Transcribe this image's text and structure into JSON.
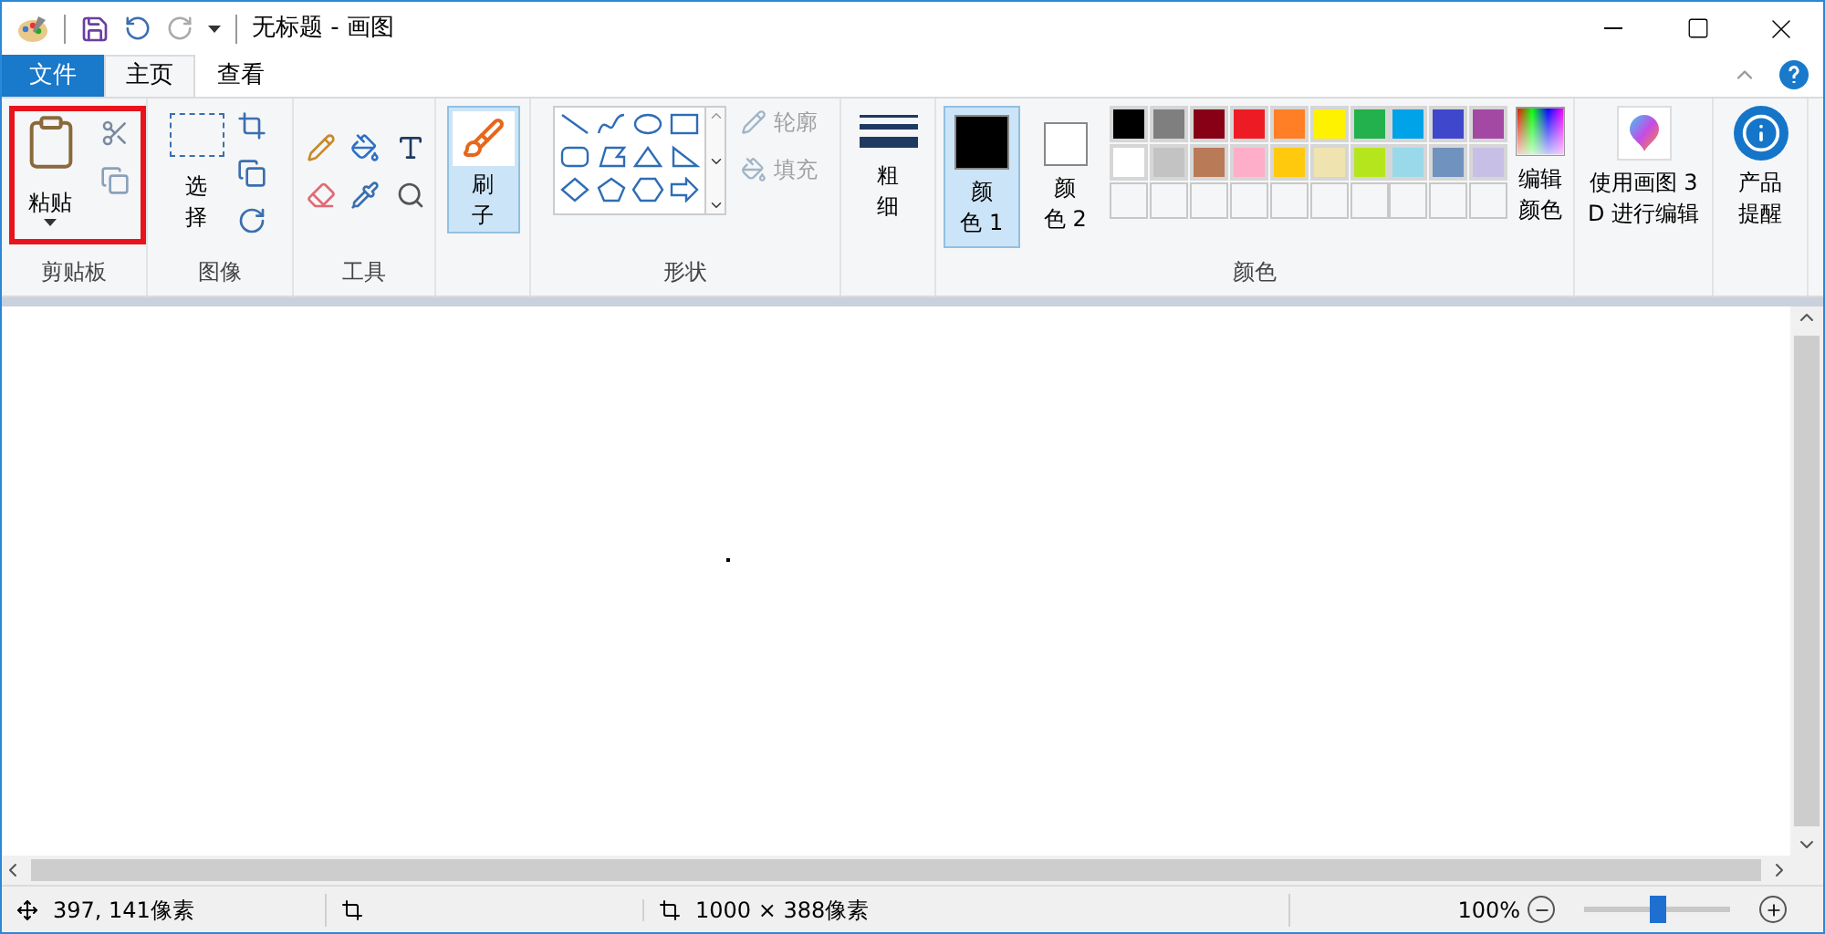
{
  "window": {
    "title": "无标题 - 画图"
  },
  "tabs": [
    {
      "label": "文件",
      "kind": "file",
      "selected": false
    },
    {
      "label": "主页",
      "kind": "tab",
      "selected": true
    },
    {
      "label": "查看",
      "kind": "tab",
      "selected": false
    }
  ],
  "ribbon": {
    "clipboard": {
      "label": "剪贴板",
      "paste": "粘贴",
      "highlighted": true
    },
    "image": {
      "label": "图像",
      "select": "选择"
    },
    "tools": {
      "label": "工具"
    },
    "brushes": {
      "label": "刷子",
      "selected": true
    },
    "shapes": {
      "label": "形状",
      "outline": "轮廓",
      "fill": "填充",
      "disabled": true
    },
    "size": {
      "label": "粗细"
    },
    "colors": {
      "label": "颜色",
      "selectors": [
        {
          "label": "颜色 1",
          "color": "#000000",
          "selected": true
        },
        {
          "label": "颜色 2",
          "color": "#ffffff",
          "selected": false
        }
      ],
      "palette": [
        {
          "kind": "color",
          "color": "#000000"
        },
        {
          "kind": "color",
          "color": "#7f7f7f"
        },
        {
          "kind": "color",
          "color": "#880015"
        },
        {
          "kind": "color",
          "color": "#ed1c24"
        },
        {
          "kind": "color",
          "color": "#ff7f27"
        },
        {
          "kind": "color",
          "color": "#fff200"
        },
        {
          "kind": "color",
          "color": "#22b14c"
        },
        {
          "kind": "color",
          "color": "#00a2e8"
        },
        {
          "kind": "color",
          "color": "#3f48cc"
        },
        {
          "kind": "color",
          "color": "#a349a4"
        },
        {
          "kind": "color",
          "color": "#ffffff"
        },
        {
          "kind": "color",
          "color": "#c3c3c3"
        },
        {
          "kind": "color",
          "color": "#b97a57"
        },
        {
          "kind": "color",
          "color": "#ffaec9"
        },
        {
          "kind": "color",
          "color": "#ffc90e"
        },
        {
          "kind": "color",
          "color": "#efe4b0"
        },
        {
          "kind": "color",
          "color": "#b5e61d"
        },
        {
          "kind": "color",
          "color": "#99d9ea"
        },
        {
          "kind": "color",
          "color": "#7092be"
        },
        {
          "kind": "color",
          "color": "#c8bfe7"
        },
        {
          "kind": "empty"
        },
        {
          "kind": "empty"
        },
        {
          "kind": "empty"
        },
        {
          "kind": "empty"
        },
        {
          "kind": "empty"
        },
        {
          "kind": "empty"
        },
        {
          "kind": "empty"
        },
        {
          "kind": "empty"
        },
        {
          "kind": "empty"
        },
        {
          "kind": "empty"
        }
      ],
      "edit": "编辑颜色"
    },
    "paint3d": "使用画图 3D 进行编辑",
    "product_alert": "产品提醒"
  },
  "status_bar": {
    "position": "397, 141像素",
    "canvas_size": "1000 × 388像素",
    "zoom": "100%",
    "zoom_slider": {
      "level": 0.5
    }
  }
}
